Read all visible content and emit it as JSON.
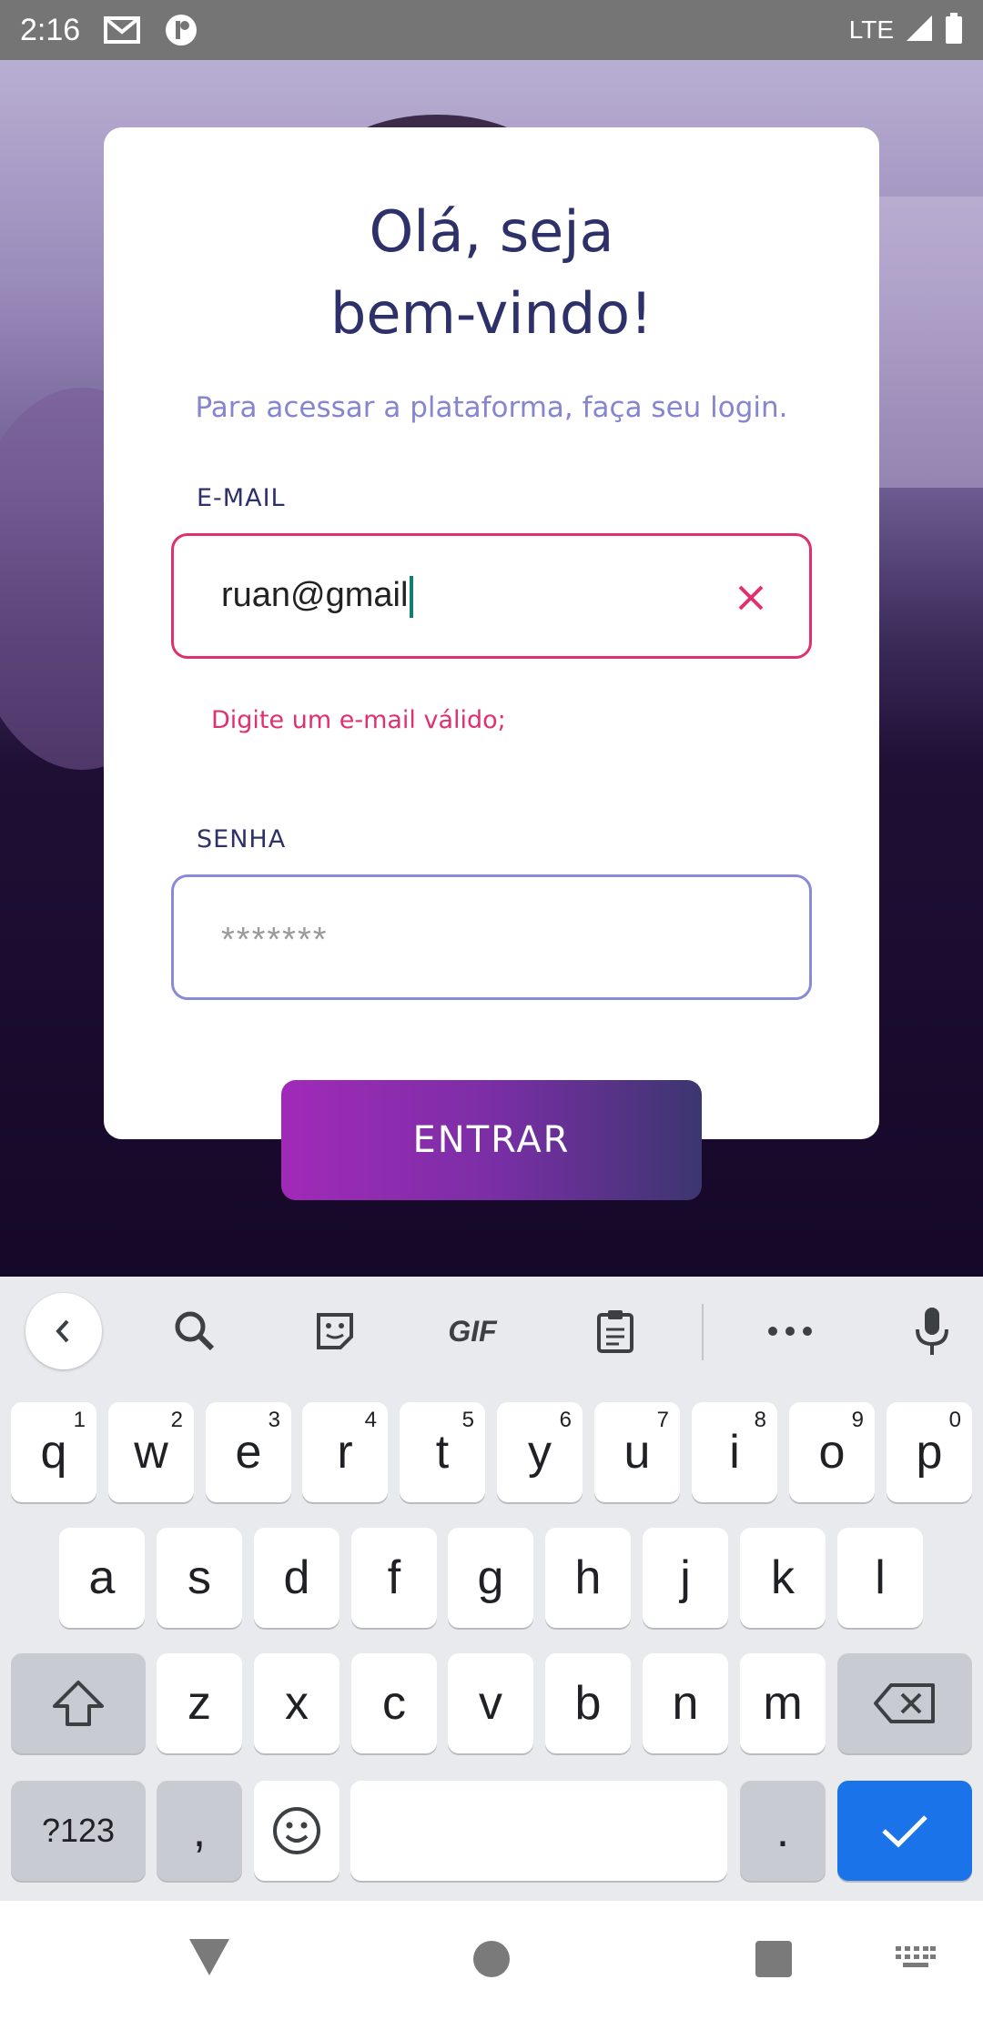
{
  "status_bar": {
    "time": "2:16",
    "network": "LTE",
    "icons": [
      "gmail-icon",
      "app-icon",
      "signal-icon",
      "battery-icon"
    ]
  },
  "login": {
    "title_line1": "Olá, seja",
    "title_line2": "bem-vindo!",
    "subtitle": "Para acessar a plataforma, faça seu login.",
    "email": {
      "label": "E-MAIL",
      "value": "ruan@gmail",
      "error": "Digite um e-mail válido;"
    },
    "password": {
      "label": "SENHA",
      "placeholder": "*******"
    },
    "submit_label": "ENTRAR"
  },
  "keyboard": {
    "toolbar": [
      "back",
      "search",
      "sticker",
      "GIF",
      "clipboard",
      "more",
      "mic"
    ],
    "gif_label": "GIF",
    "row1": [
      {
        "k": "q",
        "s": "1"
      },
      {
        "k": "w",
        "s": "2"
      },
      {
        "k": "e",
        "s": "3"
      },
      {
        "k": "r",
        "s": "4"
      },
      {
        "k": "t",
        "s": "5"
      },
      {
        "k": "y",
        "s": "6"
      },
      {
        "k": "u",
        "s": "7"
      },
      {
        "k": "i",
        "s": "8"
      },
      {
        "k": "o",
        "s": "9"
      },
      {
        "k": "p",
        "s": "0"
      }
    ],
    "row2": [
      "a",
      "s",
      "d",
      "f",
      "g",
      "h",
      "j",
      "k",
      "l"
    ],
    "row3": [
      "z",
      "x",
      "c",
      "v",
      "b",
      "n",
      "m"
    ],
    "symbols_label": "?123",
    "comma": ",",
    "period": "."
  },
  "colors": {
    "accent": "#e0306f",
    "title": "#2e3169",
    "subtitle": "#8585d0",
    "button_start": "#a12ab8",
    "button_end": "#3c3670",
    "keyboard_action": "#1a73e8"
  }
}
